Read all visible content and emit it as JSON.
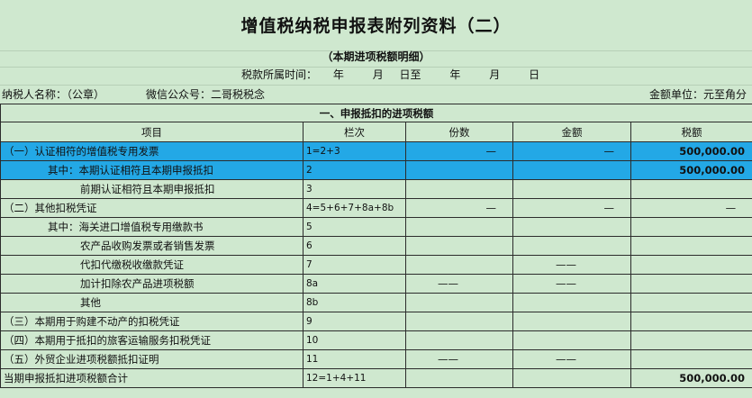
{
  "title": "增值税纳税申报表附列资料（二）",
  "subtitle": "（本期进项税额明细）",
  "period": {
    "label": "税款所属时间：",
    "year1": "年",
    "month1": "月",
    "day_to": "日至",
    "year2": "年",
    "month2": "月",
    "day2": "日"
  },
  "taxpayer_label": "纳税人名称：（公章）",
  "wechat_label": "微信公众号：二哥税税念",
  "unit_label": "金额单位：元至角分",
  "section_title": "一、申报抵扣的进项税额",
  "headers": [
    "项目",
    "栏次",
    "份数",
    "金额",
    "税额"
  ],
  "rows": [
    {
      "item": "（一）认证相符的增值税专用发票",
      "code": "1=2+3",
      "count": "—",
      "amount": "—",
      "tax": "500,000.00",
      "highlight": true
    },
    {
      "item": "其中：本期认证相符且本期申报抵扣",
      "code": "2",
      "count": "",
      "amount": "",
      "tax": "500,000.00",
      "highlight": true
    },
    {
      "item": "前期认证相符且本期申报抵扣",
      "code": "3",
      "count": "",
      "amount": "",
      "tax": ""
    },
    {
      "item": "（二）其他扣税凭证",
      "code": "4=5+6+7+8a+8b",
      "count": "—",
      "amount": "—",
      "tax": "—"
    },
    {
      "item": "其中：海关进口增值税专用缴款书",
      "code": "5",
      "count": "",
      "amount": "",
      "tax": ""
    },
    {
      "item": "农产品收购发票或者销售发票",
      "code": "6",
      "count": "",
      "amount": "",
      "tax": ""
    },
    {
      "item": "代扣代缴税收缴款凭证",
      "code": "7",
      "count": "",
      "amount": "——",
      "tax": ""
    },
    {
      "item": "加计扣除农产品进项税额",
      "code": "8a",
      "count": "——",
      "amount": "——",
      "tax": ""
    },
    {
      "item": "其他",
      "code": "8b",
      "count": "",
      "amount": "",
      "tax": ""
    },
    {
      "item": "（三）本期用于购建不动产的扣税凭证",
      "code": "9",
      "count": "",
      "amount": "",
      "tax": ""
    },
    {
      "item": "（四）本期用于抵扣的旅客运输服务扣税凭证",
      "code": "10",
      "count": "",
      "amount": "",
      "tax": ""
    },
    {
      "item": "（五）外贸企业进项税额抵扣证明",
      "code": "11",
      "count": "——",
      "amount": "——",
      "tax": ""
    },
    {
      "item": "当期申报抵扣进项税额合计",
      "code": "12=1+4+11",
      "count": "",
      "amount": "",
      "tax": "500,000.00"
    }
  ]
}
